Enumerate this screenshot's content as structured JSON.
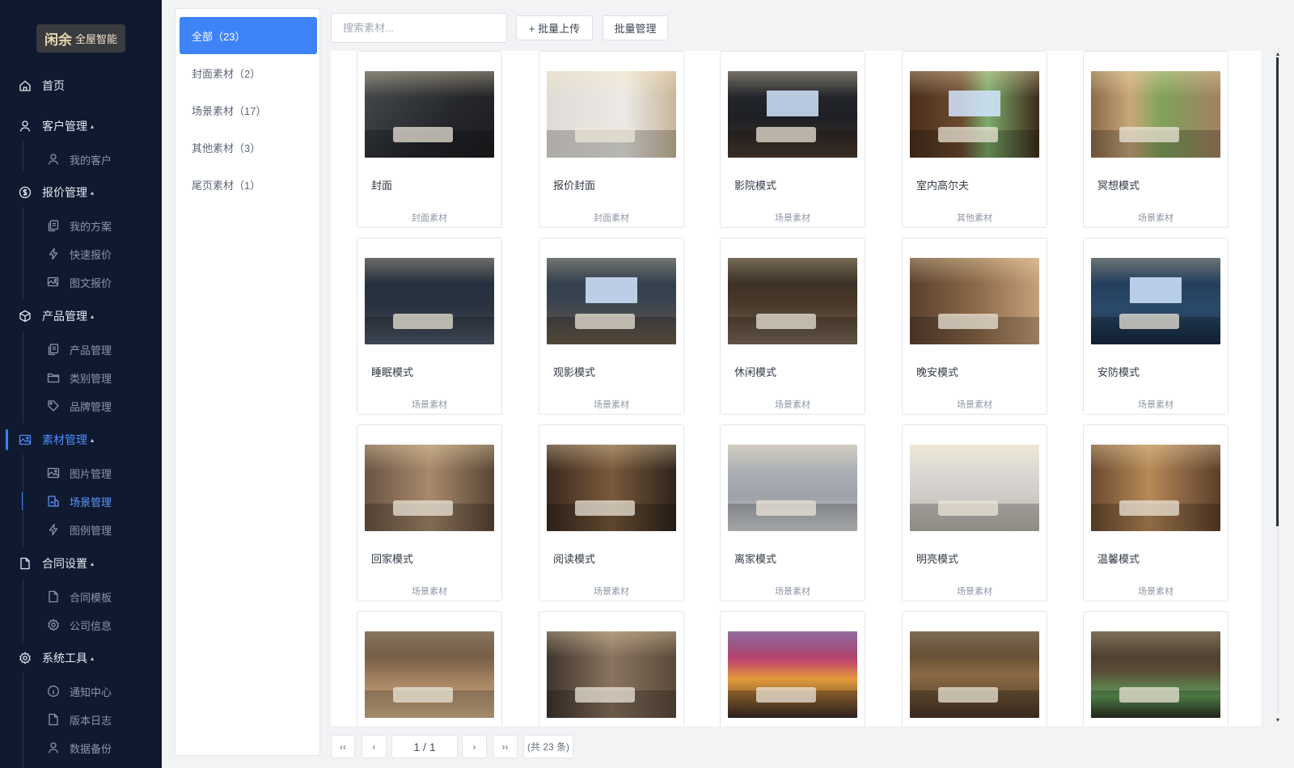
{
  "sidebar": {
    "logo": {
      "mark": "闲余",
      "text": "全屋智能"
    },
    "items": [
      {
        "label": "首页",
        "type": "top",
        "icon": "home-icon",
        "name": "sidebar-item-home"
      },
      {
        "label": "客户管理",
        "type": "top",
        "icon": "user-icon",
        "caret": true,
        "name": "sidebar-item-customer"
      },
      {
        "label": "我的客户",
        "type": "sub",
        "icon": "user-icon",
        "name": "sidebar-item-my-customers"
      },
      {
        "label": "报价管理",
        "type": "top",
        "icon": "dollar-icon",
        "caret": true,
        "name": "sidebar-item-quote"
      },
      {
        "label": "我的方案",
        "type": "sub",
        "icon": "copy-icon",
        "name": "sidebar-item-my-plans"
      },
      {
        "label": "快速报价",
        "type": "sub",
        "icon": "lightning-icon",
        "name": "sidebar-item-quick-quote"
      },
      {
        "label": "图文报价",
        "type": "sub",
        "icon": "image-edit-icon",
        "name": "sidebar-item-image-quote"
      },
      {
        "label": "产品管理",
        "type": "top",
        "icon": "box-icon",
        "caret": true,
        "name": "sidebar-item-products"
      },
      {
        "label": "产品管理",
        "type": "sub",
        "icon": "copy-icon",
        "name": "sidebar-item-product-list"
      },
      {
        "label": "类别管理",
        "type": "sub",
        "icon": "folder-icon",
        "name": "sidebar-item-categories"
      },
      {
        "label": "品牌管理",
        "type": "sub",
        "icon": "tag-icon",
        "name": "sidebar-item-brands"
      },
      {
        "label": "素材管理",
        "type": "top",
        "icon": "picture-icon",
        "caret": true,
        "active": true,
        "name": "sidebar-item-materials"
      },
      {
        "label": "图片管理",
        "type": "sub",
        "icon": "picture-icon",
        "name": "sidebar-item-images"
      },
      {
        "label": "场景管理",
        "type": "sub",
        "icon": "scene-icon",
        "active": true,
        "name": "sidebar-item-scenes"
      },
      {
        "label": "图例管理",
        "type": "sub",
        "icon": "lightning-icon",
        "name": "sidebar-item-legends"
      },
      {
        "label": "合同设置",
        "type": "top",
        "icon": "file-icon",
        "caret": true,
        "name": "sidebar-item-contracts"
      },
      {
        "label": "合同模板",
        "type": "sub",
        "icon": "file-icon",
        "name": "sidebar-item-contract-templates"
      },
      {
        "label": "公司信息",
        "type": "sub",
        "icon": "gear-icon",
        "name": "sidebar-item-company-info"
      },
      {
        "label": "系统工具",
        "type": "top",
        "icon": "gear-icon",
        "caret": true,
        "name": "sidebar-item-system-tools"
      },
      {
        "label": "通知中心",
        "type": "sub",
        "icon": "info-icon",
        "name": "sidebar-item-notifications"
      },
      {
        "label": "版本日志",
        "type": "sub",
        "icon": "file-icon",
        "name": "sidebar-item-changelog"
      },
      {
        "label": "数据备份",
        "type": "sub",
        "icon": "user-icon",
        "name": "sidebar-item-backup"
      }
    ]
  },
  "categories": [
    {
      "label": "全部（23）",
      "active": true
    },
    {
      "label": "封面素材（2）"
    },
    {
      "label": "场景素材（17）"
    },
    {
      "label": "其他素材（3）"
    },
    {
      "label": "尾页素材（1）"
    }
  ],
  "toolbar": {
    "search_placeholder": "搜索素材...",
    "upload_label": "+ 批量上传",
    "manage_label": "批量管理"
  },
  "cards": [
    {
      "title": "封面",
      "tag": "封面素材",
      "theme": "dark-product"
    },
    {
      "title": "报价封面",
      "tag": "封面素材",
      "theme": "light-product"
    },
    {
      "title": "影院模式",
      "tag": "场景素材",
      "theme": "dark-cinema"
    },
    {
      "title": "室内高尔夫",
      "tag": "其他素材",
      "theme": "golf"
    },
    {
      "title": "冥想模式",
      "tag": "场景素材",
      "theme": "forest"
    },
    {
      "title": "睡眠模式",
      "tag": "场景素材",
      "theme": "night-blue"
    },
    {
      "title": "观影模式",
      "tag": "场景素材",
      "theme": "blue-led"
    },
    {
      "title": "休闲模式",
      "tag": "场景素材",
      "theme": "warm-dark"
    },
    {
      "title": "晚安模式",
      "tag": "场景素材",
      "theme": "warm-wood"
    },
    {
      "title": "安防模式",
      "tag": "场景素材",
      "theme": "security-blue"
    },
    {
      "title": "回家模式",
      "tag": "场景素材",
      "theme": "hall-brown"
    },
    {
      "title": "阅读模式",
      "tag": "场景素材",
      "theme": "reading"
    },
    {
      "title": "离家模式",
      "tag": "场景素材",
      "theme": "gray-room"
    },
    {
      "title": "明亮模式",
      "tag": "场景素材",
      "theme": "bright"
    },
    {
      "title": "温馨模式",
      "tag": "场景素材",
      "theme": "cozy"
    },
    {
      "title": "",
      "tag": "",
      "theme": "live"
    },
    {
      "title": "",
      "tag": "",
      "theme": "study"
    },
    {
      "title": "",
      "tag": "",
      "theme": "party"
    },
    {
      "title": "",
      "tag": "",
      "theme": "zen"
    },
    {
      "title": "",
      "tag": "",
      "theme": "golf-green"
    }
  ],
  "pagination": {
    "first": "‹‹",
    "prev": "‹",
    "current": "1 / 1",
    "next": "›",
    "last": "››",
    "total": "(共 23 条)"
  },
  "colors": {
    "sidebar_bg": "#0f1a30",
    "accent": "#3f83f8"
  }
}
